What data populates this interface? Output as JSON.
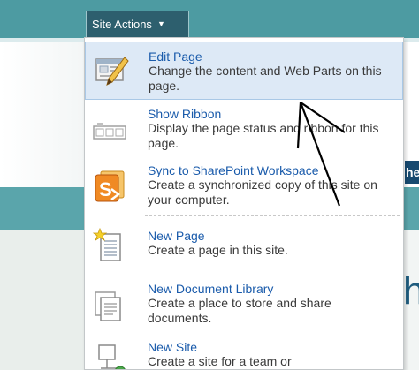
{
  "background": {
    "right_tab_text": "he",
    "right_heading_text": "h"
  },
  "site_actions": {
    "label": "Site Actions",
    "caret": "▼"
  },
  "menu": {
    "items": [
      {
        "title": "Edit Page",
        "description": "Change the content and Web Parts on this page.",
        "icon": "edit-page-icon"
      },
      {
        "title": "Show Ribbon",
        "description": "Display the page status and ribbon for this page.",
        "icon": "ribbon-icon"
      },
      {
        "title": "Sync to SharePoint Workspace",
        "description": "Create a synchronized copy of this site on your computer.",
        "icon": "sharepoint-workspace-icon"
      },
      {
        "title": "New Page",
        "description": "Create a page in this site.",
        "icon": "new-page-icon"
      },
      {
        "title": "New Document Library",
        "description": "Create a place to store and share documents.",
        "icon": "document-library-icon"
      },
      {
        "title": "New Site",
        "description": "Create a site for a team or",
        "icon": "new-site-icon"
      }
    ]
  },
  "colors": {
    "header_band": "#4d9ba2",
    "site_actions_bg": "#2d5f6e",
    "highlight_bg": "#dde9f6",
    "title_link": "#1a5bab",
    "description": "#3a3a3a"
  }
}
